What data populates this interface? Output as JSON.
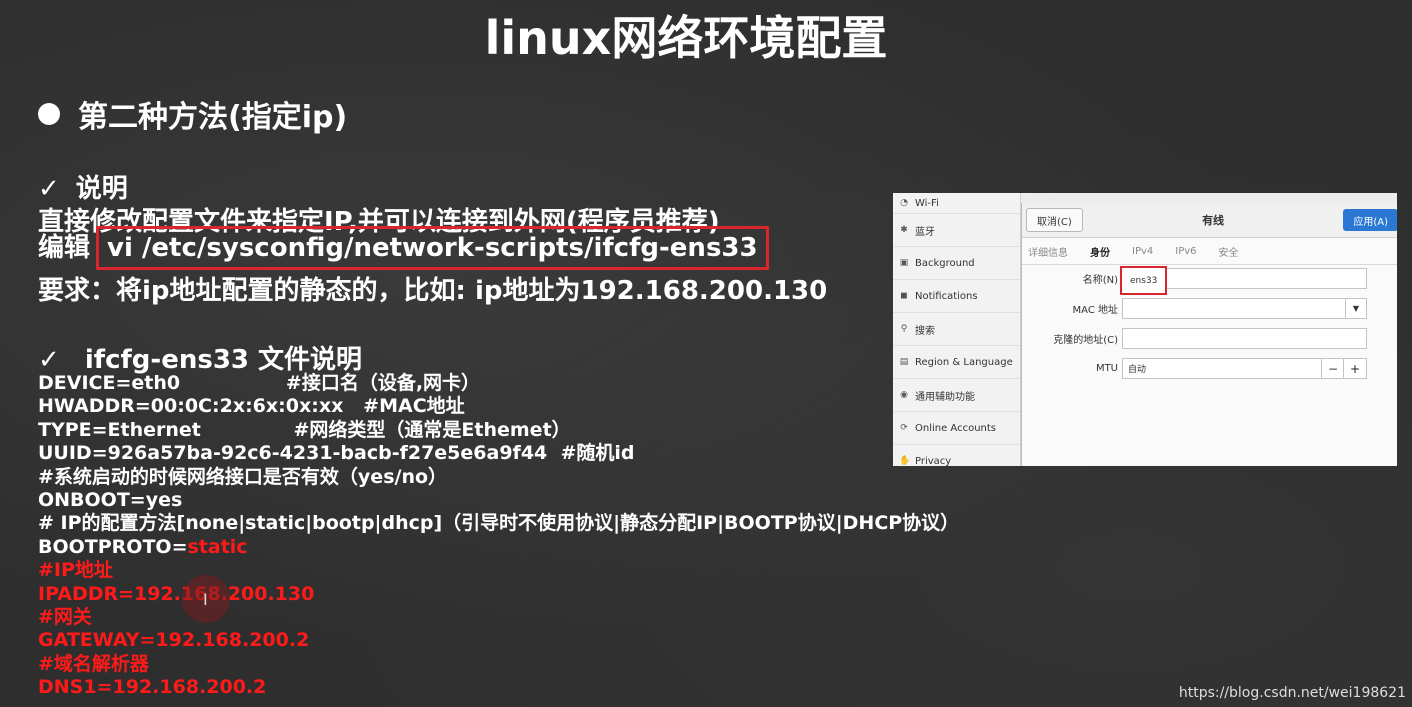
{
  "title": "linux网络环境配置",
  "section_heading": "第二种方法(指定ip)",
  "explain": {
    "heading": "说明",
    "line1": "直接修改配置文件来指定IP,并可以连接到外网(程序员推荐)",
    "edit_label": "编辑",
    "edit_cmd": "vi /etc/sysconfig/network-scripts/ifcfg-ens33",
    "require": "要求：将ip地址配置的静态的，比如: ip地址为192.168.200.130"
  },
  "file_heading": "ifcfg-ens33 文件说明",
  "code_lines": [
    {
      "text": "DEVICE=eth0                #接口名（设备,网卡）",
      "red": ""
    },
    {
      "text": "HWADDR=00:0C:2x:6x:0x:xx   #MAC地址",
      "red": ""
    },
    {
      "text": "TYPE=Ethernet              #网络类型（通常是Ethemet）",
      "red": ""
    },
    {
      "text": "UUID=926a57ba-92c6-4231-bacb-f27e5e6a9f44  #随机id",
      "red": ""
    },
    {
      "text": "#系统启动的时候网络接口是否有效（yes/no）",
      "red": ""
    },
    {
      "text": "ONBOOT=yes",
      "red": ""
    },
    {
      "text": "# IP的配置方法[none|static|bootp|dhcp]（引导时不使用协议|静态分配IP|BOOTP协议|DHCP协议）",
      "red": ""
    },
    {
      "text": "BOOTPROTO=",
      "red": "static"
    },
    {
      "text": "",
      "red": "#IP地址"
    },
    {
      "text": "",
      "red": "IPADDR=192.168.200.130"
    },
    {
      "text": "",
      "red": "#网关"
    },
    {
      "text": "",
      "red": "GATEWAY=192.168.200.2"
    },
    {
      "text": "",
      "red": "#域名解析器"
    },
    {
      "text": "",
      "red": "DNS1=192.168.200.2"
    }
  ],
  "settings": {
    "sidebar": [
      {
        "icon": "wifi-icon",
        "glyph": "◔",
        "label": "Wi-Fi"
      },
      {
        "icon": "bluetooth-icon",
        "glyph": "✱",
        "label": "蓝牙"
      },
      {
        "icon": "background-icon",
        "glyph": "▣",
        "label": "Background"
      },
      {
        "icon": "notifications-icon",
        "glyph": "◼",
        "label": "Notifications"
      },
      {
        "icon": "search-icon",
        "glyph": "⚲",
        "label": "搜索"
      },
      {
        "icon": "region-icon",
        "glyph": "▤",
        "label": "Region & Language"
      },
      {
        "icon": "accessibility-icon",
        "glyph": "◉",
        "label": "通用辅助功能"
      },
      {
        "icon": "online-accounts-icon",
        "glyph": "⟳",
        "label": "Online Accounts"
      },
      {
        "icon": "privacy-icon",
        "glyph": "✋",
        "label": "Privacy"
      }
    ],
    "dialog": {
      "cancel": "取消(C)",
      "title": "有线",
      "apply": "应用(A)",
      "tabs": [
        "详细信息",
        "身份",
        "IPv4",
        "IPv6",
        "安全"
      ],
      "active_tab": "身份",
      "name_label": "名称(N)",
      "name_value": "ens33",
      "mac_label": "MAC 地址",
      "mac_value": "",
      "clone_label": "克隆的地址(C)",
      "clone_value": "",
      "mtu_label": "MTU",
      "mtu_value": "自动",
      "minus": "−",
      "plus": "+"
    }
  },
  "watermark": "https://blog.csdn.net/wei198621",
  "colors": {
    "highlight": "#ff1a1a",
    "box": "#d8262e",
    "apply": "#2b77d4"
  }
}
